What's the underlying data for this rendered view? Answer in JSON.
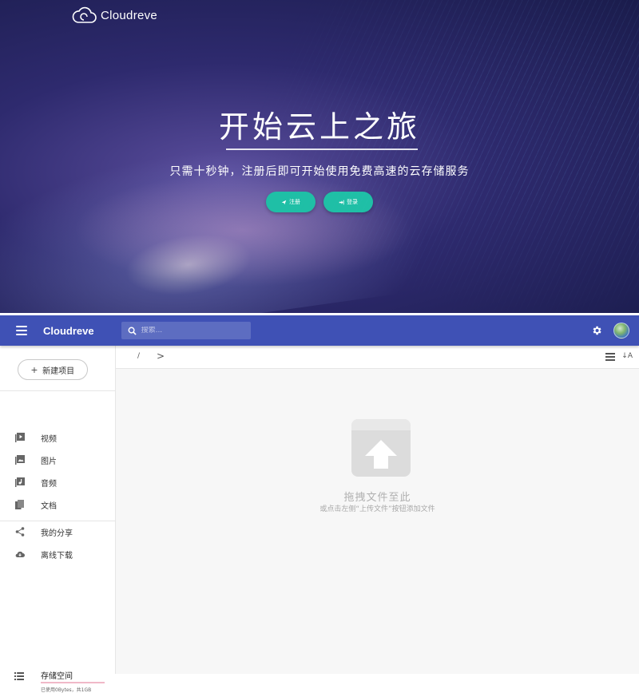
{
  "hero": {
    "brand": "Cloudreve",
    "title": "开始云上之旅",
    "subtitle": "只需十秒钟，注册后即可开始使用免费高速的云存储服务",
    "register_label": "注册",
    "login_label": "登录",
    "accent_color": "#1fbfa6"
  },
  "appbar": {
    "title": "Cloudreve",
    "search_placeholder": "搜索...",
    "color": "#3f51b5"
  },
  "sidebar": {
    "new_button": "新建项目",
    "items": [
      {
        "label": "视频",
        "icon": "video-library-icon"
      },
      {
        "label": "图片",
        "icon": "image-icon"
      },
      {
        "label": "音频",
        "icon": "music-library-icon"
      },
      {
        "label": "文档",
        "icon": "document-icon"
      },
      {
        "label": "我的分享",
        "icon": "share-icon"
      },
      {
        "label": "离线下载",
        "icon": "cloud-download-icon"
      }
    ],
    "storage": {
      "title": "存储空间",
      "detail": "已使用0Bytes，共1GB",
      "used_fraction": 0.0
    }
  },
  "main": {
    "breadcrumb_root": "/",
    "breadcrumb_next": ">",
    "sort_label": "↓A",
    "drop_title": "拖拽文件至此",
    "drop_hint": "或点击左侧“上传文件”按钮添加文件"
  }
}
